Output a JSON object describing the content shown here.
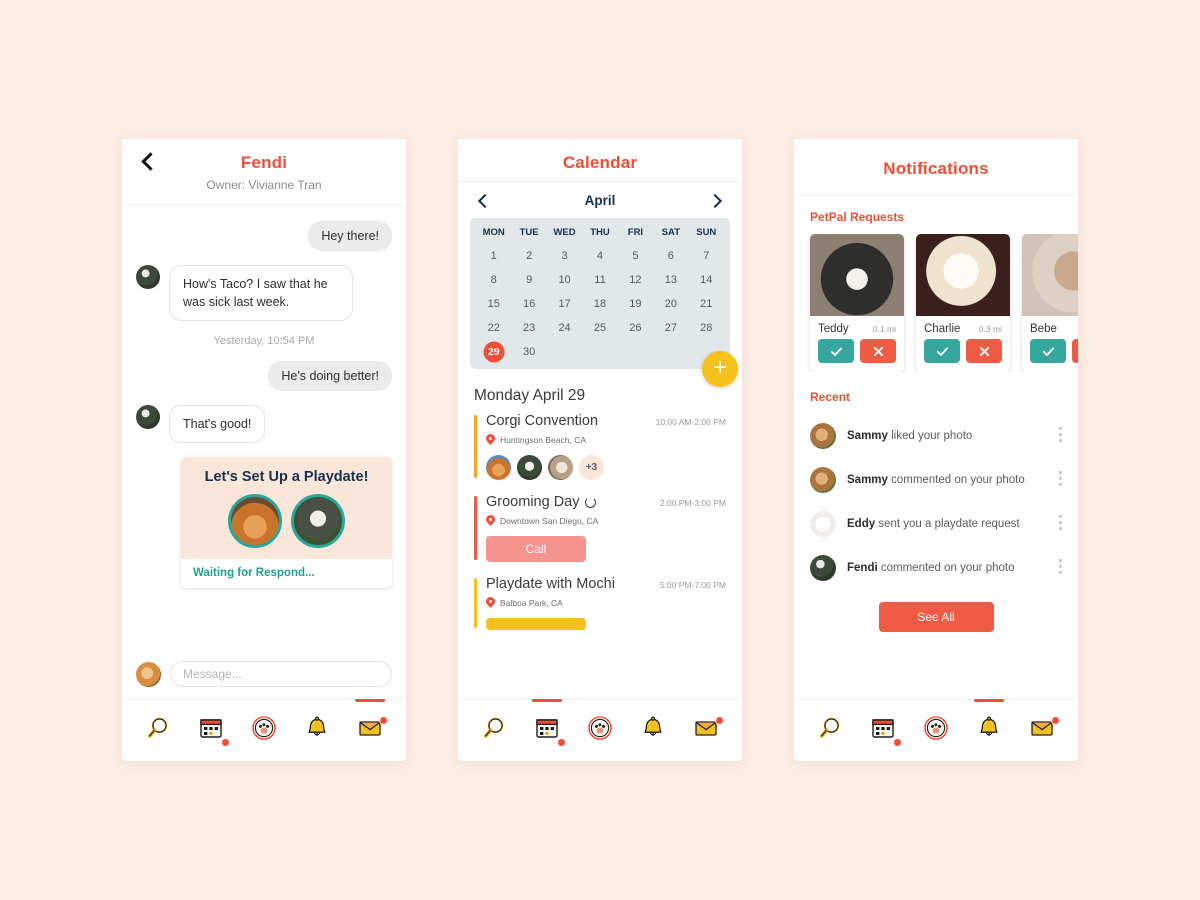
{
  "colors": {
    "page_bg": "#fbeee4",
    "accent_red": "#ef4f38",
    "teal": "#2aa79b",
    "yellow": "#f6c01e",
    "navy": "#16304e",
    "salmon": "#f4948e"
  },
  "chat": {
    "back_icon": "chevron-left-icon",
    "title": "Fendi",
    "subtitle": "Owner: Vivianne Tran",
    "messages": [
      {
        "side": "out",
        "text": "Hey there!"
      },
      {
        "side": "in",
        "text": "How's Taco? I saw that he was sick last week."
      },
      {
        "side": "stamp",
        "text": "Yesterday, 10:54 PM"
      },
      {
        "side": "out",
        "text": "He's doing better!"
      },
      {
        "side": "in",
        "text": "That's good!"
      }
    ],
    "playdate_card": {
      "title": "Let's Set Up a Playdate!",
      "status": "Waiting for Respond..."
    },
    "composer": {
      "placeholder": "Message...",
      "value": ""
    }
  },
  "calendar": {
    "title": "Calendar",
    "prev_icon": "chevron-left-icon",
    "next_icon": "chevron-right-icon",
    "month": "April",
    "dow": [
      "MON",
      "TUE",
      "WED",
      "THU",
      "FRI",
      "SAT",
      "SUN"
    ],
    "days": [
      1,
      2,
      3,
      4,
      5,
      6,
      7,
      8,
      9,
      10,
      11,
      12,
      13,
      14,
      15,
      16,
      17,
      18,
      19,
      20,
      21,
      22,
      23,
      24,
      25,
      26,
      27,
      28,
      29,
      30
    ],
    "selected_day": 29,
    "add_icon": "plus-icon",
    "add_label": "+",
    "day_heading": "Monday April 29",
    "events": [
      {
        "name": "Corgi Convention",
        "time": "10:00 AM-2:00 PM",
        "location": "Huntingson Beach, CA",
        "bar_color": "#f6a623",
        "repeat": false,
        "attendees_more": "+3",
        "attendee_count": 3,
        "button": null
      },
      {
        "name": "Grooming Day",
        "time": "2:00 PM-3:00 PM",
        "location": "Downtown San Diego, CA",
        "bar_color": "#ef5b45",
        "repeat": true,
        "button": {
          "label": "Call",
          "color": "#f4948e"
        }
      },
      {
        "name": "Playdate with Mochi",
        "time": "5:00 PM-7:00 PM",
        "location": "Balboa Park, CA",
        "bar_color": "#f6c01e",
        "repeat": false,
        "button": {
          "label": "",
          "color": "#f6c01e"
        }
      }
    ]
  },
  "notifications": {
    "title": "Notifications",
    "requests_title": "PetPal Requests",
    "requests": [
      {
        "name": "Teddy",
        "distance": "0.1 mi",
        "accept_icon": "check-icon",
        "decline_icon": "close-icon"
      },
      {
        "name": "Charlie",
        "distance": "0.3 mi",
        "accept_icon": "check-icon",
        "decline_icon": "close-icon"
      },
      {
        "name": "Bebe",
        "distance": "",
        "accept_icon": "check-icon",
        "decline_icon": "close-icon"
      }
    ],
    "recent_title": "Recent",
    "recent": [
      {
        "actor": "Sammy",
        "action": " liked your photo"
      },
      {
        "actor": "Sammy",
        "action": " commented on your photo"
      },
      {
        "actor": "Eddy",
        "action": " sent you a playdate request"
      },
      {
        "actor": "Fendi",
        "action": " commented on your photo"
      }
    ],
    "see_all": "See All"
  },
  "tabbar": {
    "items": [
      {
        "icon": "search-icon",
        "badge": false
      },
      {
        "icon": "calendar-icon",
        "badge": true
      },
      {
        "icon": "paw-icon",
        "badge": false
      },
      {
        "icon": "bell-icon",
        "badge": false
      },
      {
        "icon": "envelope-icon",
        "badge": true
      }
    ],
    "active": {
      "chat": 4,
      "calendar": 1,
      "notifications": 3
    }
  }
}
